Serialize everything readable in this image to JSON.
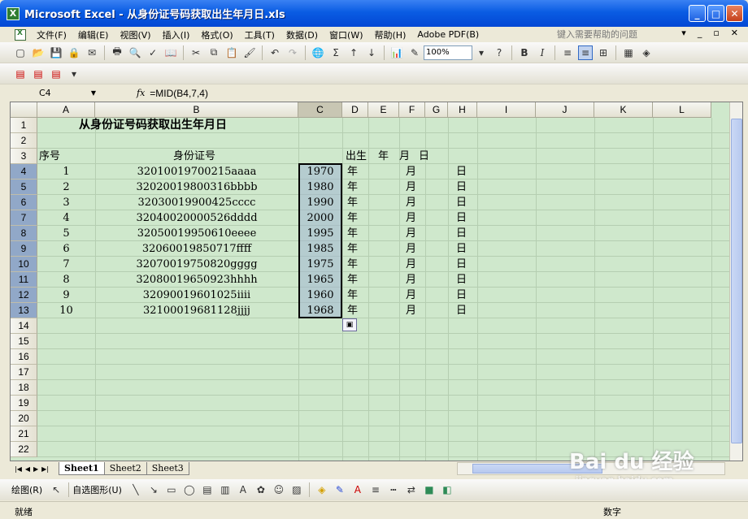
{
  "window": {
    "title": "Microsoft Excel - 从身份证号码获取出生年月日.xls",
    "app_icon": "X"
  },
  "menu": {
    "items": [
      "文件(F)",
      "编辑(E)",
      "视图(V)",
      "插入(I)",
      "格式(O)",
      "工具(T)",
      "数据(D)",
      "窗口(W)",
      "帮助(H)",
      "Adobe PDF(B)"
    ],
    "help_placeholder": "键入需要帮助的问题"
  },
  "toolbar": {
    "zoom": "100%",
    "bold": "B",
    "italic": "I",
    "sum": "Σ"
  },
  "formula_bar": {
    "name_box": "C4",
    "fx": "fx",
    "formula": "=MID(B4,7,4)"
  },
  "grid": {
    "columns": [
      "A",
      "B",
      "C",
      "D",
      "E",
      "F",
      "G",
      "H",
      "I",
      "J",
      "K",
      "L"
    ],
    "rows": [
      "1",
      "2",
      "3",
      "4",
      "5",
      "6",
      "7",
      "8",
      "9",
      "10",
      "11",
      "12",
      "13",
      "14",
      "15",
      "16",
      "17",
      "18",
      "19",
      "20",
      "21",
      "22"
    ],
    "selected_column": "C",
    "title": "从身份证号码获取出生年月日",
    "header_seq": "序号",
    "header_id": "身份证号",
    "header_birth": "出生",
    "header_year": "年",
    "header_month": "月",
    "header_day": "日",
    "data": [
      {
        "seq": "1",
        "id": "32010019700215aaaa",
        "year": "1970",
        "y": "年",
        "m": "月",
        "d": "日"
      },
      {
        "seq": "2",
        "id": "32020019800316bbbb",
        "year": "1980",
        "y": "年",
        "m": "月",
        "d": "日"
      },
      {
        "seq": "3",
        "id": "32030019900425cccc",
        "year": "1990",
        "y": "年",
        "m": "月",
        "d": "日"
      },
      {
        "seq": "4",
        "id": "32040020000526dddd",
        "year": "2000",
        "y": "年",
        "m": "月",
        "d": "日"
      },
      {
        "seq": "5",
        "id": "32050019950610eeee",
        "year": "1995",
        "y": "年",
        "m": "月",
        "d": "日"
      },
      {
        "seq": "6",
        "id": "32060019850717ffff",
        "year": "1985",
        "y": "年",
        "m": "月",
        "d": "日"
      },
      {
        "seq": "7",
        "id": "32070019750820gggg",
        "year": "1975",
        "y": "年",
        "m": "月",
        "d": "日"
      },
      {
        "seq": "8",
        "id": "32080019650923hhhh",
        "year": "1965",
        "y": "年",
        "m": "月",
        "d": "日"
      },
      {
        "seq": "9",
        "id": "32090019601025iiii",
        "year": "1960",
        "y": "年",
        "m": "月",
        "d": "日"
      },
      {
        "seq": "10",
        "id": "32100019681128jjjj",
        "year": "1968",
        "y": "年",
        "m": "月",
        "d": "日"
      }
    ]
  },
  "sheets": {
    "tabs": [
      "Sheet1",
      "Sheet2",
      "Sheet3"
    ],
    "active": "Sheet1"
  },
  "drawing": {
    "draw_label": "绘图(R)",
    "autoshapes_label": "自选图形(U)"
  },
  "status": {
    "left": "就绪",
    "right": "数字"
  },
  "watermark": {
    "brand": "Bai du 经验",
    "url": "jingyan.baidu.com"
  },
  "colors": {
    "grid_background": "#cfe8cc",
    "titlebar": "#0a5ce3",
    "selection": "#a0b4d2"
  }
}
